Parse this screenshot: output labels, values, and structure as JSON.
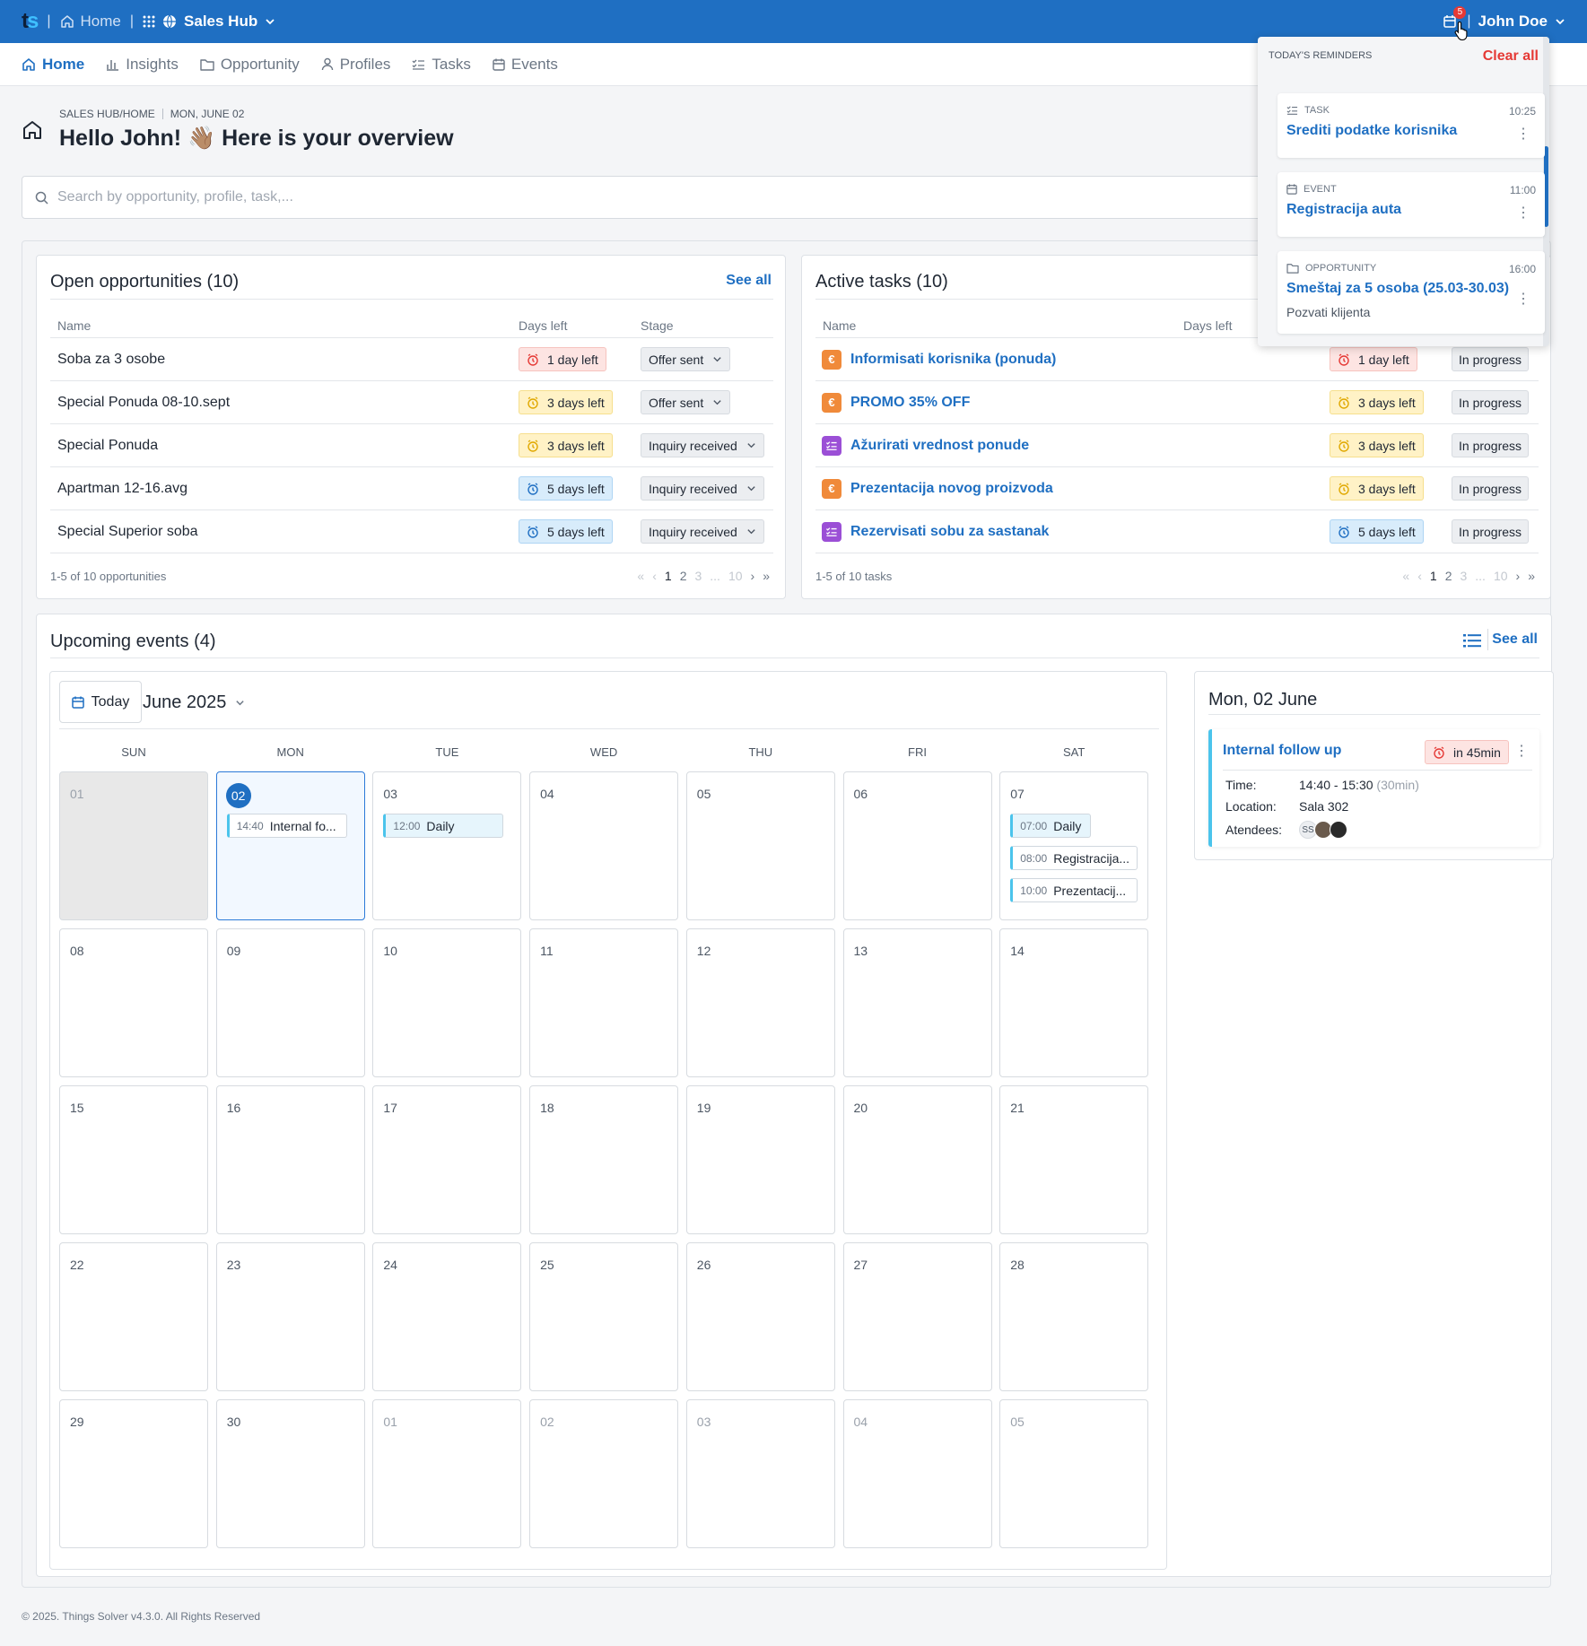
{
  "topbar": {
    "home_label": "Home",
    "hub_label": "Sales Hub",
    "notification_count": "5",
    "user_name": "John Doe",
    "colors": {
      "bar": "#1f6fc2"
    }
  },
  "nav": {
    "items": [
      {
        "label": "Home",
        "icon": "home-icon"
      },
      {
        "label": "Insights",
        "icon": "chart-icon"
      },
      {
        "label": "Opportunity",
        "icon": "folder-icon"
      },
      {
        "label": "Profiles",
        "icon": "user-icon"
      },
      {
        "label": "Tasks",
        "icon": "tasks-icon"
      },
      {
        "label": "Events",
        "icon": "calendar-icon"
      }
    ]
  },
  "header": {
    "breadcrumb": "SALES HUB/HOME",
    "date": "MON, JUNE 02",
    "greeting": "Hello John! 👋🏽 Here is your overview"
  },
  "search": {
    "placeholder": "Search by opportunity, profile, task,..."
  },
  "opportunities": {
    "title": "Open opportunities (10)",
    "see_all": "See all",
    "col_name": "Name",
    "col_days": "Days left",
    "col_stage": "Stage",
    "rows": [
      {
        "name": "Soba za 3 osobe",
        "days": "1 day left",
        "urgency": "red",
        "stage": "Offer sent"
      },
      {
        "name": "Special Ponuda 08-10.sept",
        "days": "3 days left",
        "urgency": "yellow",
        "stage": "Offer sent"
      },
      {
        "name": "Special Ponuda",
        "days": "3 days left",
        "urgency": "yellow",
        "stage": "Inquiry received"
      },
      {
        "name": "Apartman 12-16.avg",
        "days": "5 days left",
        "urgency": "blue",
        "stage": "Inquiry received"
      },
      {
        "name": "Special Superior soba",
        "days": "5 days left",
        "urgency": "blue",
        "stage": "Inquiry received"
      }
    ],
    "summary": "1-5 of 10 opportunities",
    "pages": [
      "1",
      "2",
      "3",
      "...",
      "10"
    ]
  },
  "tasks": {
    "title": "Active tasks (10)",
    "col_name": "Name",
    "col_days": "Days left",
    "rows": [
      {
        "name": "Informisati korisnika (ponuda)",
        "icon": "euro-icon",
        "days": "1 day left",
        "urgency": "red",
        "status": "In progress"
      },
      {
        "name": "PROMO 35% OFF",
        "icon": "euro-icon",
        "days": "3 days left",
        "urgency": "yellow",
        "status": "In progress"
      },
      {
        "name": "Ažurirati vrednost ponude",
        "icon": "checklist-icon",
        "days": "3 days left",
        "urgency": "yellow",
        "status": "In progress"
      },
      {
        "name": "Prezentacija novog proizvoda",
        "icon": "euro-icon",
        "days": "3 days left",
        "urgency": "yellow",
        "status": "In progress"
      },
      {
        "name": "Rezervisati sobu za sastanak",
        "icon": "checklist-icon",
        "days": "5 days left",
        "urgency": "blue",
        "status": "In progress"
      }
    ],
    "summary": "1-5 of 10 tasks",
    "pages": [
      "1",
      "2",
      "3",
      "...",
      "10"
    ]
  },
  "events": {
    "title": "Upcoming events (4)",
    "see_all": "See all",
    "today_label": "Today",
    "month_label": "June 2025",
    "weekdays": [
      "SUN",
      "MON",
      "TUE",
      "WED",
      "THU",
      "FRI",
      "SAT"
    ],
    "weeks": [
      [
        "01",
        "02",
        "03",
        "04",
        "05",
        "06",
        "07"
      ],
      [
        "08",
        "09",
        "10",
        "11",
        "12",
        "13",
        "14"
      ],
      [
        "15",
        "16",
        "17",
        "18",
        "19",
        "20",
        "21"
      ],
      [
        "22",
        "23",
        "24",
        "25",
        "26",
        "27",
        "28"
      ],
      [
        "29",
        "30",
        "01",
        "02",
        "03",
        "04",
        "05"
      ]
    ],
    "calendar_events": {
      "mon02": {
        "time": "14:40",
        "title": "Internal fo..."
      },
      "tue03": {
        "time": "12:00",
        "title": "Daily"
      },
      "sat07": [
        {
          "time": "07:00",
          "title": "Daily"
        },
        {
          "time": "08:00",
          "title": "Registracija..."
        },
        {
          "time": "10:00",
          "title": "Prezentacij..."
        }
      ]
    },
    "side": {
      "date_title": "Mon, 02 June",
      "event_title": "Internal follow up",
      "countdown": "in 45min",
      "time_label": "Time:",
      "time_value": "14:40 - 15:30",
      "duration": "(30min)",
      "location_label": "Location:",
      "location_value": "Sala 302",
      "attendees_label": "Atendees:",
      "attendee_initials": "SS"
    }
  },
  "reminders": {
    "title": "TODAY'S REMINDERS",
    "clear_all": "Clear all",
    "items": [
      {
        "type": "TASK",
        "time": "10:25",
        "title": "Srediti podatke korisnika",
        "subtitle": ""
      },
      {
        "type": "EVENT",
        "time": "11:00",
        "title": "Registracija auta",
        "subtitle": ""
      },
      {
        "type": "OPPORTUNITY",
        "time": "16:00",
        "title": "Smeštaj za 5 osoba (25.03-30.03)",
        "subtitle": "Pozvati klijenta"
      }
    ]
  },
  "footer": {
    "text": "© 2025. Things Solver v4.3.0. All Rights Reserved"
  }
}
